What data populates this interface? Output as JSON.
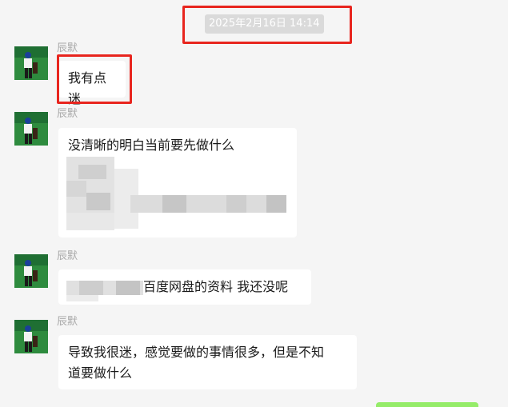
{
  "timestamp": "2025年2月16日 14:14",
  "messages": [
    {
      "sender": "辰默",
      "text": "我有点迷"
    },
    {
      "sender": "辰默",
      "text": "没清晰的明白当前要先做什么"
    },
    {
      "sender": "辰默",
      "text": "百度网盘的资料 我还没呢"
    },
    {
      "sender": "辰默",
      "text_line1": "导致我很迷，感觉要做的事情很多，但是不知",
      "text_line2": "道要做什么"
    }
  ],
  "icons": {
    "avatar": "user-avatar-photo"
  },
  "colors": {
    "background": "#f5f5f5",
    "bubble_received": "#ffffff",
    "bubble_sent": "#95ec69",
    "highlight_box": "#e8251e",
    "timestamp_bg": "#dadada"
  }
}
